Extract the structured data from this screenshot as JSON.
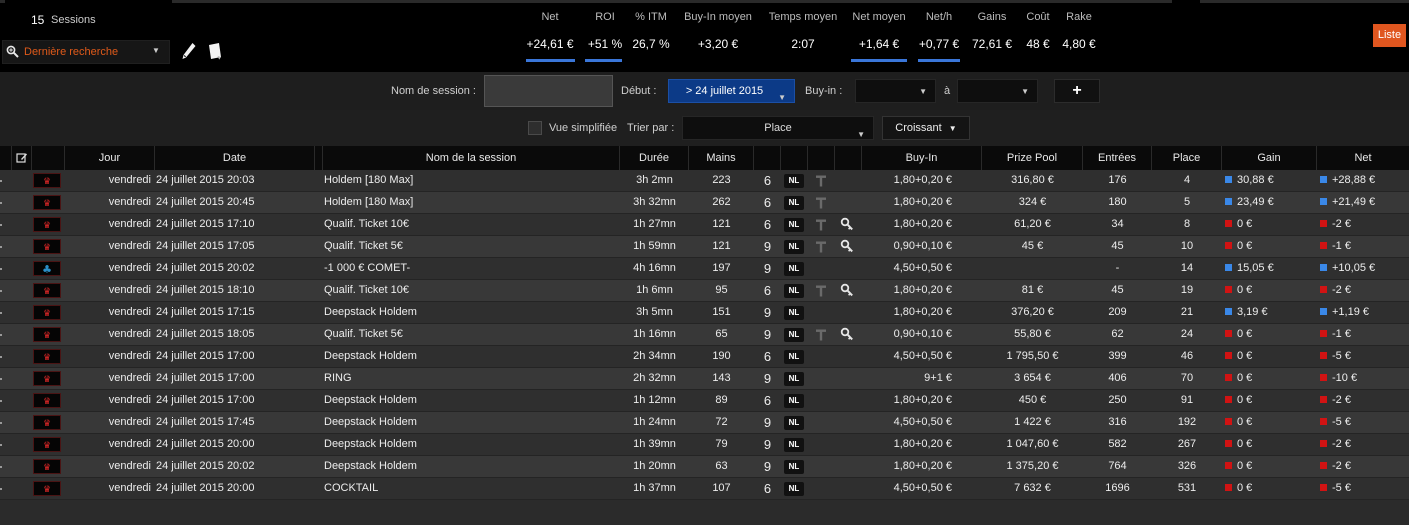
{
  "header": {
    "sessions_count": "15",
    "sessions_label": "Sessions",
    "search_value": "Dernière recherche",
    "list_button": "Liste",
    "stats": [
      {
        "label": "Net",
        "value": "+24,61 €",
        "highlight": true
      },
      {
        "label": "ROI",
        "value": "+51 %",
        "highlight": true
      },
      {
        "label": "% ITM",
        "value": "26,7 %",
        "highlight": false
      },
      {
        "label": "Buy-In moyen",
        "value": "+3,20 €",
        "highlight": false
      },
      {
        "label": "Temps moyen",
        "value": "2:07",
        "highlight": false
      },
      {
        "label": "Net moyen",
        "value": "+1,64 €",
        "highlight": true
      },
      {
        "label": "Net/h",
        "value": "+0,77 €",
        "highlight": true
      },
      {
        "label": "Gains",
        "value": "72,61 €",
        "highlight": false
      },
      {
        "label": "Coût",
        "value": "48 €",
        "highlight": false
      },
      {
        "label": "Rake",
        "value": "4,80 €",
        "highlight": false
      }
    ]
  },
  "filters": {
    "session_name_label": "Nom de session :",
    "session_name_value": "",
    "start_label": "Début :",
    "start_value": "> 24 juillet 2015",
    "buyin_label": "Buy-in :",
    "buyin_from": "",
    "to_label": "à",
    "buyin_to": "",
    "add_label": "+",
    "simplified_label": "Vue simplifiée",
    "simplified_checked": false,
    "sort_label": "Trier par :",
    "sort_value": "Place",
    "order_value": "Croissant"
  },
  "table": {
    "columns": {
      "jour": "Jour",
      "date": "Date",
      "name": "Nom de la session",
      "duree": "Durée",
      "mains": "Mains",
      "buyin": "Buy-In",
      "prize": "Prize Pool",
      "entrees": "Entrées",
      "place": "Place",
      "gain": "Gain",
      "net": "Net"
    },
    "rows": [
      {
        "site": "casino-icon",
        "jour": "vendredi",
        "date": "24 juillet 2015 20:03",
        "name": "Holdem [180 Max]",
        "duree": "3h 2mn",
        "mains": "223",
        "speed": "6",
        "limit": "NL",
        "ticket": "T",
        "key": false,
        "buyin": "1,80+0,20 €",
        "prize": "316,80 €",
        "entrees": "176",
        "place": "4",
        "gain": "30,88 €",
        "gain_pos": true,
        "net": "+28,88 €",
        "net_pos": true
      },
      {
        "site": "casino-icon",
        "jour": "vendredi",
        "date": "24 juillet 2015 20:45",
        "name": "Holdem [180 Max]",
        "duree": "3h 32mn",
        "mains": "262",
        "speed": "6",
        "limit": "NL",
        "ticket": "T",
        "key": false,
        "buyin": "1,80+0,20 €",
        "prize": "324 €",
        "entrees": "180",
        "place": "5",
        "gain": "23,49 €",
        "gain_pos": true,
        "net": "+21,49 €",
        "net_pos": true
      },
      {
        "site": "casino-icon",
        "jour": "vendredi",
        "date": "24 juillet 2015 17:10",
        "name": "Qualif. Ticket 10€",
        "duree": "1h 27mn",
        "mains": "121",
        "speed": "6",
        "limit": "NL",
        "ticket": "T",
        "key": true,
        "buyin": "1,80+0,20 €",
        "prize": "61,20 €",
        "entrees": "34",
        "place": "8",
        "gain": "0 €",
        "gain_pos": false,
        "net": "-2 €",
        "net_pos": false
      },
      {
        "site": "casino-icon",
        "jour": "vendredi",
        "date": "24 juillet 2015 17:05",
        "name": "Qualif. Ticket 5€",
        "duree": "1h 59mn",
        "mains": "121",
        "speed": "9",
        "limit": "NL",
        "ticket": "T",
        "key": true,
        "buyin": "0,90+0,10 €",
        "prize": "45 €",
        "entrees": "45",
        "place": "10",
        "gain": "0 €",
        "gain_pos": false,
        "net": "-1 €",
        "net_pos": false
      },
      {
        "site": "club-icon",
        "jour": "vendredi",
        "date": "24 juillet 2015 20:02",
        "name": "-1 000 € COMET-",
        "duree": "4h 16mn",
        "mains": "197",
        "speed": "9",
        "limit": "NL",
        "ticket": "",
        "key": false,
        "buyin": "4,50+0,50 €",
        "prize": "",
        "entrees": "-",
        "place": "14",
        "gain": "15,05 €",
        "gain_pos": true,
        "net": "+10,05 €",
        "net_pos": true
      },
      {
        "site": "casino-icon",
        "jour": "vendredi",
        "date": "24 juillet 2015 18:10",
        "name": "Qualif. Ticket 10€",
        "duree": "1h 6mn",
        "mains": "95",
        "speed": "6",
        "limit": "NL",
        "ticket": "T",
        "key": true,
        "buyin": "1,80+0,20 €",
        "prize": "81 €",
        "entrees": "45",
        "place": "19",
        "gain": "0 €",
        "gain_pos": false,
        "net": "-2 €",
        "net_pos": false
      },
      {
        "site": "casino-icon",
        "jour": "vendredi",
        "date": "24 juillet 2015 17:15",
        "name": "Deepstack Holdem",
        "duree": "3h 5mn",
        "mains": "151",
        "speed": "9",
        "limit": "NL",
        "ticket": "",
        "key": false,
        "buyin": "1,80+0,20 €",
        "prize": "376,20 €",
        "entrees": "209",
        "place": "21",
        "gain": "3,19 €",
        "gain_pos": true,
        "net": "+1,19 €",
        "net_pos": true
      },
      {
        "site": "casino-icon",
        "jour": "vendredi",
        "date": "24 juillet 2015 18:05",
        "name": "Qualif. Ticket 5€",
        "duree": "1h 16mn",
        "mains": "65",
        "speed": "9",
        "limit": "NL",
        "ticket": "T",
        "key": true,
        "buyin": "0,90+0,10 €",
        "prize": "55,80 €",
        "entrees": "62",
        "place": "24",
        "gain": "0 €",
        "gain_pos": false,
        "net": "-1 €",
        "net_pos": false
      },
      {
        "site": "casino-icon",
        "jour": "vendredi",
        "date": "24 juillet 2015 17:00",
        "name": "Deepstack Holdem",
        "duree": "2h 34mn",
        "mains": "190",
        "speed": "6",
        "limit": "NL",
        "ticket": "",
        "key": false,
        "buyin": "4,50+0,50 €",
        "prize": "1 795,50 €",
        "entrees": "399",
        "place": "46",
        "gain": "0 €",
        "gain_pos": false,
        "net": "-5 €",
        "net_pos": false
      },
      {
        "site": "casino-icon",
        "jour": "vendredi",
        "date": "24 juillet 2015 17:00",
        "name": "RING",
        "duree": "2h 32mn",
        "mains": "143",
        "speed": "9",
        "limit": "NL",
        "ticket": "",
        "key": false,
        "buyin": "9+1 €",
        "prize": "3 654 €",
        "entrees": "406",
        "place": "70",
        "gain": "0 €",
        "gain_pos": false,
        "net": "-10 €",
        "net_pos": false
      },
      {
        "site": "casino-icon",
        "jour": "vendredi",
        "date": "24 juillet 2015 17:00",
        "name": "Deepstack Holdem",
        "duree": "1h 12mn",
        "mains": "89",
        "speed": "6",
        "limit": "NL",
        "ticket": "",
        "key": false,
        "buyin": "1,80+0,20 €",
        "prize": "450 €",
        "entrees": "250",
        "place": "91",
        "gain": "0 €",
        "gain_pos": false,
        "net": "-2 €",
        "net_pos": false
      },
      {
        "site": "casino-icon",
        "jour": "vendredi",
        "date": "24 juillet 2015 17:45",
        "name": "Deepstack Holdem",
        "duree": "1h 24mn",
        "mains": "72",
        "speed": "9",
        "limit": "NL",
        "ticket": "",
        "key": false,
        "buyin": "4,50+0,50 €",
        "prize": "1 422 €",
        "entrees": "316",
        "place": "192",
        "gain": "0 €",
        "gain_pos": false,
        "net": "-5 €",
        "net_pos": false
      },
      {
        "site": "casino-icon",
        "jour": "vendredi",
        "date": "24 juillet 2015 20:00",
        "name": "Deepstack Holdem",
        "duree": "1h 39mn",
        "mains": "79",
        "speed": "9",
        "limit": "NL",
        "ticket": "",
        "key": false,
        "buyin": "1,80+0,20 €",
        "prize": "1 047,60 €",
        "entrees": "582",
        "place": "267",
        "gain": "0 €",
        "gain_pos": false,
        "net": "-2 €",
        "net_pos": false
      },
      {
        "site": "casino-icon",
        "jour": "vendredi",
        "date": "24 juillet 2015 20:02",
        "name": "Deepstack Holdem",
        "duree": "1h 20mn",
        "mains": "63",
        "speed": "9",
        "limit": "NL",
        "ticket": "",
        "key": false,
        "buyin": "1,80+0,20 €",
        "prize": "1 375,20 €",
        "entrees": "764",
        "place": "326",
        "gain": "0 €",
        "gain_pos": false,
        "net": "-2 €",
        "net_pos": false
      },
      {
        "site": "casino-icon",
        "jour": "vendredi",
        "date": "24 juillet 2015 20:00",
        "name": "COCKTAIL",
        "duree": "1h 37mn",
        "mains": "107",
        "speed": "6",
        "limit": "NL",
        "ticket": "",
        "key": false,
        "buyin": "4,50+0,50 €",
        "prize": "7 632 €",
        "entrees": "1696",
        "place": "531",
        "gain": "0 €",
        "gain_pos": false,
        "net": "-5 €",
        "net_pos": false
      }
    ]
  },
  "colors": {
    "accent": "#e0561f",
    "positive": "#3a88e8",
    "negative": "#d11313",
    "selected": "#0c3a87"
  }
}
